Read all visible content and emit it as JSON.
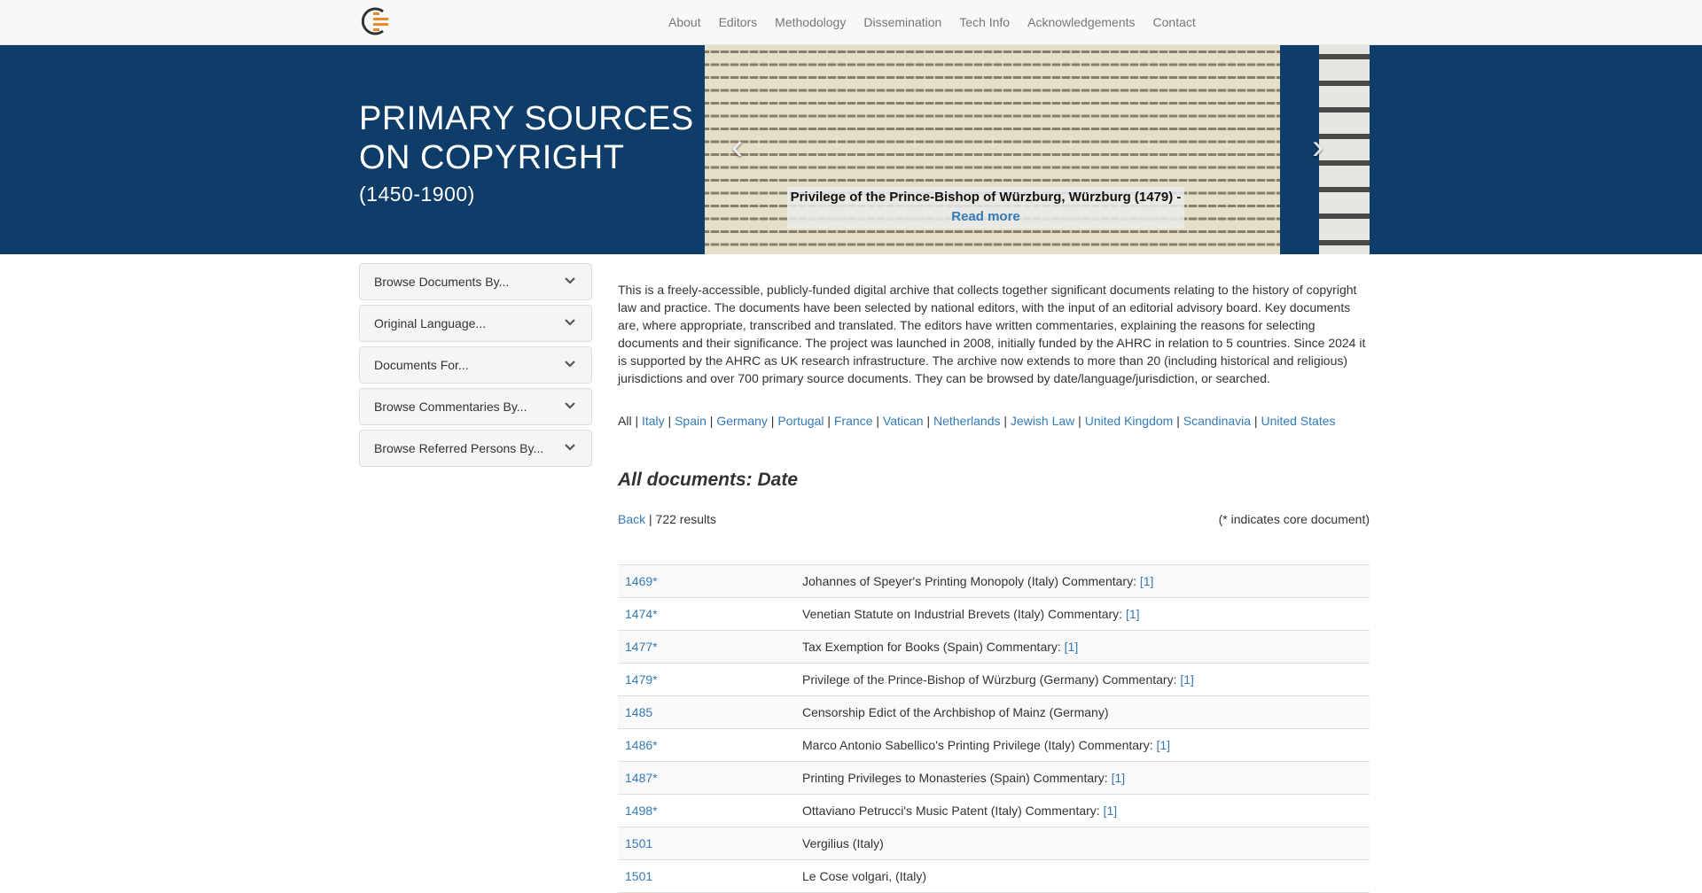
{
  "nav": {
    "logo_icon": "copyright-c-logo-icon",
    "links": [
      "About",
      "Editors",
      "Methodology",
      "Dissemination",
      "Tech Info",
      "Acknowledgements",
      "Contact"
    ]
  },
  "hero": {
    "title": "PRIMARY SOURCES ON COPYRIGHT",
    "subtitle": "(1450-1900)",
    "caption_text": "Privilege of the Prince-Bishop of Würzburg, Würzburg (1479) - ",
    "caption_link": "Read more",
    "prev_icon": "chevron-left-icon",
    "next_icon": "chevron-right-icon"
  },
  "sidebar": {
    "panels": [
      "Browse Documents By...",
      "Original Language...",
      "Documents For...",
      "Browse Commentaries By...",
      "Browse Referred Persons By..."
    ]
  },
  "main": {
    "intro": "This is a freely-accessible, publicly-funded digital archive that collects together significant documents relating to the history of copyright law and practice. The documents have been selected by national editors, with the input of an editorial advisory board. Key documents are, where appropriate, transcribed and translated. The editors have written commentaries, explaining the reasons for selecting documents and their significance. The project was launched in 2008, initially funded by the AHRC in relation to 5 countries. Since 2024 it is supported by the AHRC as UK research infrastructure. The archive now extends to more than 20 (including historical and religious) jurisdictions and over 700 primary source documents. They can be browsed by date/language/jurisdiction, or searched.",
    "filter_all": "All",
    "filters": [
      "Italy",
      "Spain",
      "Germany",
      "Portugal",
      "France",
      "Vatican",
      "Netherlands",
      "Jewish Law",
      "United Kingdom",
      "Scandinavia",
      "United States"
    ],
    "heading": "All documents: Date",
    "back_label": "Back",
    "results_count": " | 722 results",
    "core_note": "(* indicates core document)"
  },
  "documents": [
    {
      "date": "1469*",
      "title": "Johannes of Speyer's Printing Monopoly (Italy) Commentary: ",
      "commentary": "[1]"
    },
    {
      "date": "1474*",
      "title": "Venetian Statute on Industrial Brevets (Italy) Commentary: ",
      "commentary": "[1]"
    },
    {
      "date": "1477*",
      "title": "Tax Exemption for Books (Spain) Commentary: ",
      "commentary": "[1]"
    },
    {
      "date": "1479*",
      "title": "Privilege of the Prince-Bishop of Würzburg (Germany) Commentary: ",
      "commentary": "[1]"
    },
    {
      "date": "1485",
      "title": "Censorship Edict of the Archbishop of Mainz (Germany)",
      "commentary": ""
    },
    {
      "date": "1486*",
      "title": "Marco Antonio Sabellico's Printing Privilege (Italy) Commentary: ",
      "commentary": "[1]"
    },
    {
      "date": "1487*",
      "title": "Printing Privileges to Monasteries (Spain) Commentary: ",
      "commentary": "[1]"
    },
    {
      "date": "1498*",
      "title": "Ottaviano Petrucci's Music Patent (Italy) Commentary: ",
      "commentary": "[1]"
    },
    {
      "date": "1501",
      "title": "Vergilius (Italy)",
      "commentary": ""
    },
    {
      "date": "1501",
      "title": "Le Cose volgari, (Italy)",
      "commentary": ""
    }
  ]
}
